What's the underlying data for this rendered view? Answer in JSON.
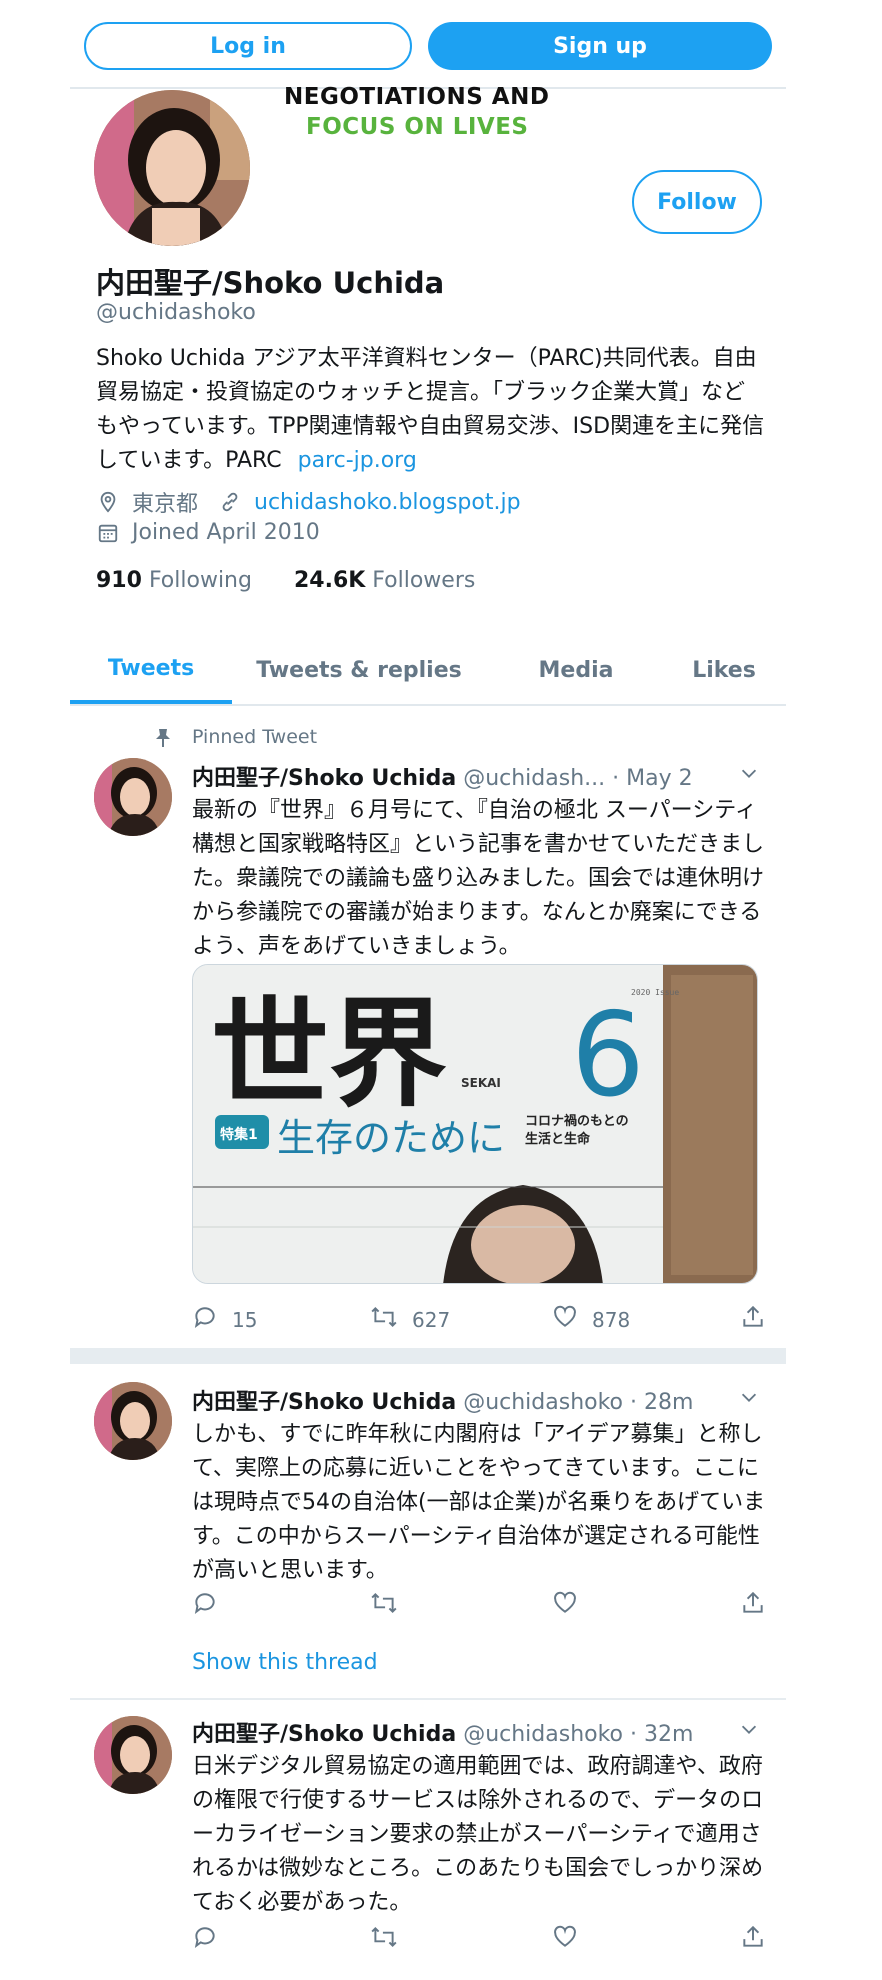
{
  "auth": {
    "login_label": "Log in",
    "signup_label": "Sign up"
  },
  "banner": {
    "line1": "NEGOTIATIONS AND",
    "line2": "FOCUS ON LIVES"
  },
  "profile": {
    "follow_label": "Follow",
    "name": "内田聖子/Shoko Uchida",
    "handle": "@uchidashoko",
    "bio_text": "Shoko Uchida アジア太平洋資料センター（PARC)共同代表。自由貿易協定・投資協定のウォッチと提言。「ブラック企業大賞」などもやっています。TPP関連情報や自由貿易交渉、ISD関連を主に発信しています。PARC",
    "bio_link": "parc-jp.org",
    "location": "東京都",
    "website": "uchidashoko.blogspot.jp",
    "joined": "Joined April 2010",
    "following_count": "910",
    "following_label": "Following",
    "followers_count": "24.6K",
    "followers_label": "Followers"
  },
  "tabs": [
    "Tweets",
    "Tweets & replies",
    "Media",
    "Likes"
  ],
  "icons": [
    "pin-icon",
    "location-icon",
    "link-icon",
    "calendar-icon",
    "chevron-down-icon",
    "reply-icon",
    "retweet-icon",
    "like-icon",
    "share-icon"
  ],
  "colors": {
    "accent": "#1da1f2",
    "link": "#1b95e0",
    "muted": "#657786",
    "banner_green": "#58b33d"
  },
  "tweets": [
    {
      "pinned_label": "Pinned Tweet",
      "name": "内田聖子/Shoko Uchida",
      "handle": "@uchidash...",
      "time": "· May 2",
      "text": "最新の『世界』６月号にて、『自治の極北 スーパーシティ構想と国家戦略特区』という記事を書かせていただきました。衆議院での議論も盛り込みました。国会では連休明けから参議院での審議が始まります。なんとか廃案にできるよう、声をあげていきましょう。",
      "media": {
        "title": "世界",
        "number": "6",
        "brand": "SEKAI",
        "feature_badge": "特集1",
        "feature_title": "生存のために",
        "feature_sub1": "コロナ禍のもとの",
        "feature_sub2": "生活と生命"
      },
      "replies": "15",
      "retweets": "627",
      "likes": "878"
    },
    {
      "name": "内田聖子/Shoko Uchida",
      "handle": "@uchidashoko",
      "time": "· 28m",
      "text": "しかも、すでに昨年秋に内閣府は「アイデア募集」と称して、実際上の応募に近いことをやってきています。ここには現時点で54の自治体(一部は企業)が名乗りをあげています。この中からスーパーシティ自治体が選定される可能性が高いと思います。",
      "thread_link": "Show this thread"
    },
    {
      "name": "内田聖子/Shoko Uchida",
      "handle": "@uchidashoko",
      "time": "· 32m",
      "text": "日米デジタル貿易協定の適用範囲では、政府調達や、政府の権限で行使するサービスは除外されるので、データのローカライゼーション要求の禁止がスーパーシティで適用されるかは微妙なところ。このあたりも国会でしっかり深めておく必要があった。"
    }
  ]
}
